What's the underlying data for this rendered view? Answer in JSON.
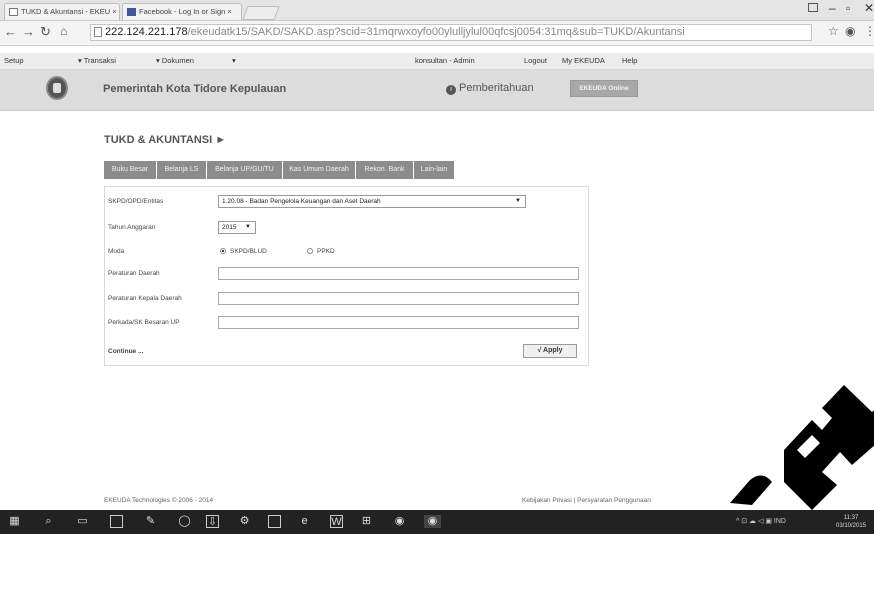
{
  "browser": {
    "tabs": [
      {
        "title": "TUKD & Akuntansi - EKEU ×"
      },
      {
        "title": "Facebook - Log In or Sign ×"
      }
    ],
    "url_host": "222.124.221.178",
    "url_path": "/ekeudatk15/SAKD/SAKD.asp?scid=31mqrwxoyfo00ylulljylul00qfcsj0054:31mq&sub=TUKD/Akuntansi"
  },
  "menubar": {
    "setup": "Setup",
    "transaksi": "▾  Transaksi",
    "dokumen": "▾  Dokumen",
    "extra_arrow": "▾",
    "user": "konsultan - Admin",
    "logout": "Logout",
    "my": "My EKEUDA",
    "help": "Help"
  },
  "header": {
    "org": "Pemerintah Kota Tidore Kepulauan",
    "notif": "Pemberitahuan",
    "ekeuda_btn": "EKEUDA Online"
  },
  "page": {
    "title": "TUKD & AKUNTANSI ►",
    "tabs": [
      "Buku Besar",
      "Belanja LS",
      "Belanja UP/GU/TU",
      "Kas Umum Daerah",
      "Rekon. Bank",
      "Lain-lain"
    ]
  },
  "form": {
    "skpd_label": "SKPD/OPD/Entitas",
    "skpd_value": "1.20.08 - Badan Pengelola Keuangan dan Aset Daerah",
    "tahun_label": "Tahun Anggaran",
    "tahun_value": "2015",
    "moda_label": "Moda",
    "moda_opt1": "SKPD/BLUD",
    "moda_opt2": "PPKD",
    "perda_label": "Peraturan Daerah",
    "perkada_label": "Peraturan Kepala Daerah",
    "sk_label": "Perkada/SK Besaran UP",
    "continue": "Continue ...",
    "apply": "√ Apply"
  },
  "footer": {
    "left": "EKEUDA Technologies © 2006 - 2014",
    "right": "Kebijakan Privasi | Persyaratan Penggunaan"
  },
  "taskbar": {
    "tray": "^  ⊡  ☁  ◁  ▣  IND",
    "time": "11:37",
    "date": "03/10/2015"
  },
  "colors": {
    "tab_bg": "#8c8c8c",
    "header_bg": "#dcdcdc",
    "taskbar_bg": "#222222"
  }
}
